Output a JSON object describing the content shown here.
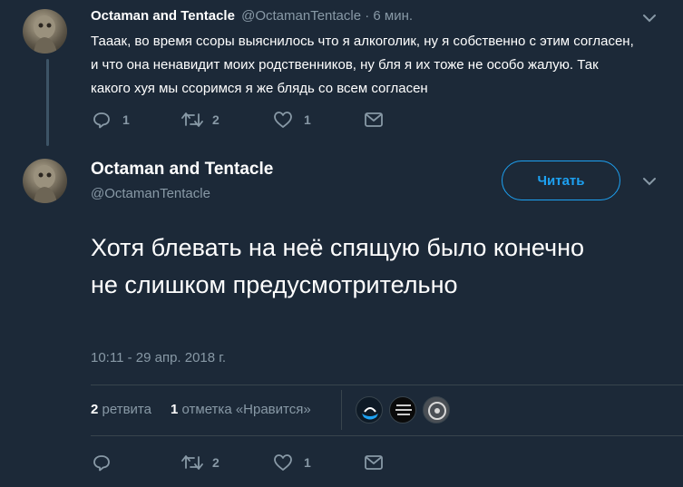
{
  "tweet1": {
    "display_name": "Octaman and Tentacle",
    "handle": "@OctamanTentacle",
    "time": "· 6 мин.",
    "text": "Тааак, во время ссоры выяснилось что я алкоголик, ну я собственно с этим согласен, и что она ненавидит моих родственников, ну бля я их тоже не особо жалую. Так какого хуя мы ссоримся я же блядь со всем согласен",
    "replies": "1",
    "retweets": "2",
    "likes": "1"
  },
  "tweet2": {
    "display_name": "Octaman and Tentacle",
    "handle": "@OctamanTentacle",
    "follow_label": "Читать",
    "text": "Хотя блевать на неё спящую было конечно не слишком предусмотрительно",
    "timestamp": "10:11 - 29 апр. 2018 г.",
    "stats": {
      "retweet_count": "2",
      "retweet_label": "ретвита",
      "like_count": "1",
      "like_label": "отметка «Нравится»"
    },
    "likers": [
      "liker-avatar-1",
      "liker-avatar-2",
      "liker-avatar-3"
    ],
    "retweets": "2",
    "likes": "1"
  },
  "colors": {
    "background": "#1c2938",
    "accent": "#1da1f2",
    "muted": "#8899a6",
    "divider": "#38444d"
  },
  "icons": [
    "reply-icon",
    "retweet-icon",
    "like-icon",
    "dm-icon",
    "chevron-down-icon"
  ]
}
